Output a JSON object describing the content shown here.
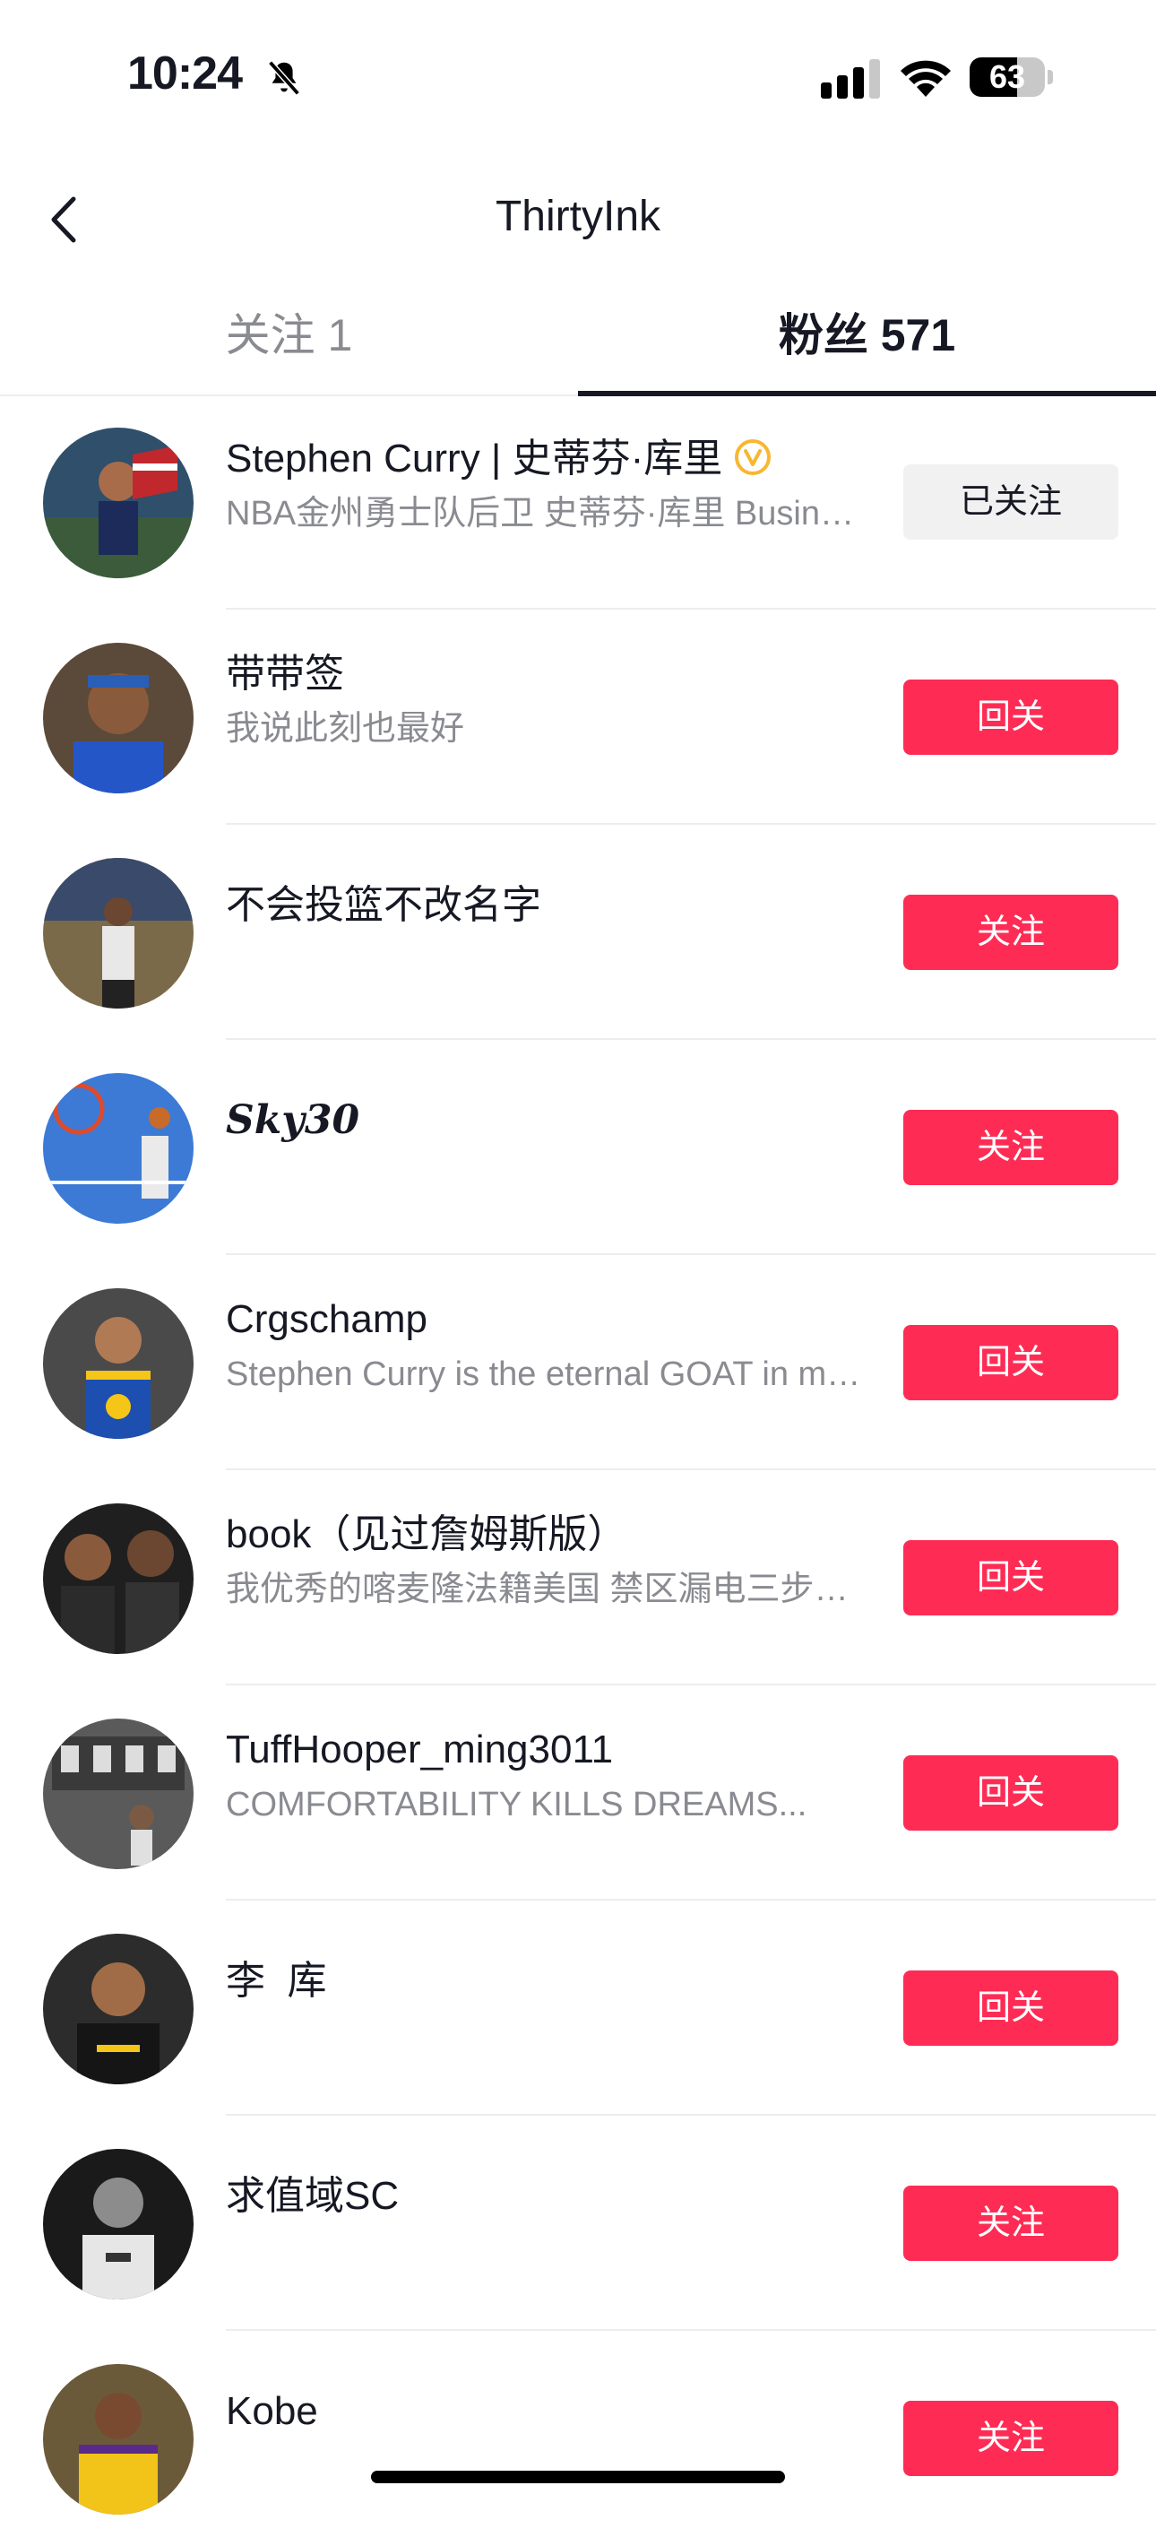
{
  "status_bar": {
    "time": "10:24",
    "battery_level": "63",
    "battery_fraction": 0.63,
    "icons": [
      "bell-slash-icon",
      "cellular-signal-icon",
      "wifi-icon",
      "battery-icon"
    ]
  },
  "nav": {
    "title": "ThirtyInk",
    "back_icon": "chevron-left-icon"
  },
  "tabs": [
    {
      "label": "关注 1",
      "active": false
    },
    {
      "label": "粉丝 571",
      "active": true
    }
  ],
  "colors": {
    "accent": "#fe2c55",
    "text_primary": "#161823",
    "text_secondary": "#8a8b91",
    "verified": "#f7b731",
    "followed_bg": "#f1f1f2"
  },
  "followers": [
    {
      "name": "Stephen Curry | 史蒂芬·库里",
      "verified": true,
      "bio": "NBA金州勇士队后卫 史蒂芬·库里 Business inquiries",
      "button": "已关注"
    },
    {
      "name": "带带签",
      "bio": "我说此刻也最好",
      "button": "回关"
    },
    {
      "name": "不会投篮不改名字",
      "bio": "",
      "button": "关注"
    },
    {
      "name": "𝑺𝒌𝒚30",
      "bio": "",
      "button": "关注"
    },
    {
      "name": "Crgschamp",
      "bio": "Stephen Curry is the eternal GOAT in my heart",
      "button": "回关"
    },
    {
      "name": "book（见过詹姆斯版）",
      "bio": "我优秀的喀麦隆法籍美国 禁区漏电三步上篮",
      "button": "回关"
    },
    {
      "name": "TuffHooper_ming3011",
      "bio": "COMFORTABILITY KILLS DREAMS...",
      "button": "回关"
    },
    {
      "name": "李  库",
      "bio": "",
      "button": "回关"
    },
    {
      "name": "求值域SC",
      "bio": "",
      "button": "关注"
    },
    {
      "name": "Kobe",
      "bio": "",
      "button": "关注"
    }
  ]
}
